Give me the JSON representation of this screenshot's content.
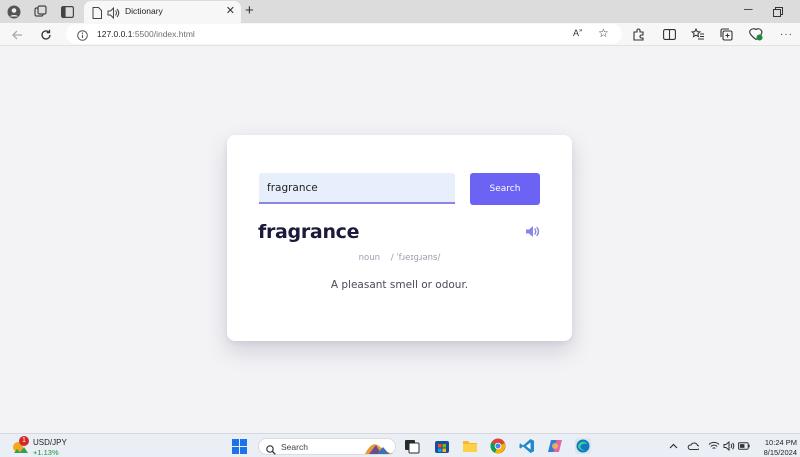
{
  "browser": {
    "tab_title": "Dictionary",
    "url_host": "127.0.0.1",
    "url_rest": ":5500/index.html"
  },
  "dictionary": {
    "search_value": "fragrance",
    "search_button": "Search",
    "word": "fragrance",
    "part_of_speech": "noun",
    "phonetic": "/ ˈfɹeɪɡɹəns/",
    "meaning": "A pleasant smell or odour.",
    "accent_color": "#6c63f4"
  },
  "taskbar": {
    "stock_name": "USD/JPY",
    "stock_change": "+1.13%",
    "notification_count": "1",
    "search_label": "Search",
    "time": "10:24 PM",
    "date": "8/15/2024"
  }
}
